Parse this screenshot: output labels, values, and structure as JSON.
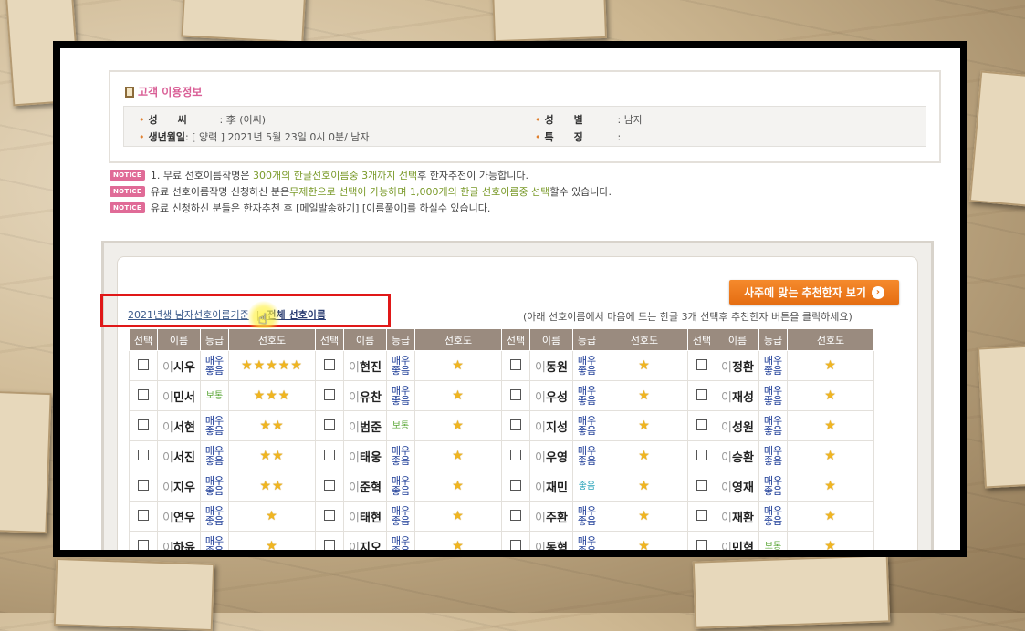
{
  "info": {
    "title": "고객 이용정보",
    "rows": [
      {
        "label": "성　　씨",
        "value": ": 李 (이씨)"
      },
      {
        "label": "생년월일",
        "value": ": [ 양력 ] 2021년 5월 23일 0시 0분/ 남자"
      },
      {
        "label": "성　　별",
        "value": ": 남자"
      },
      {
        "label": "특　　징",
        "value": ":"
      }
    ]
  },
  "notices": {
    "badge": "NOTICE",
    "n1": {
      "a": "1. 무료 선호이름작명은 ",
      "b": "300개의 한글선호이름중 3개까지 선택",
      "c": "후 한자추천이 가능합니다."
    },
    "n2": {
      "a": "유료 선호이름작명 신청하신 분은",
      "b": "무제한으로 선택이 가능하며 1,000개의 한글 선호이름중 선택",
      "c": "할수 있습니다."
    },
    "n3": {
      "a": "유료 신청하신 분들은 한자추천 후 [메일발송하기] [이름풀이]를 하실수 있습니다."
    }
  },
  "controls": {
    "link_year": "2021년생 남자선호이름기준",
    "separator": "|",
    "link_all": "전체 선호이름",
    "cta": "사주에 맞는 추천한자 보기",
    "cta_arrow": "›",
    "hint": "(아래 선호이름에서 마음에 드는 한글 3개 선택후 추천한자 버튼을 클릭하세요)"
  },
  "table": {
    "headers": [
      "선택",
      "이름",
      "등급",
      "선호도"
    ],
    "surname": "이",
    "grade_colors": {
      "최고": "#1a3a96",
      "보통": "#5ea83a",
      "좋음": "#2aa3b8"
    },
    "columns": [
      [
        {
          "given": "시우",
          "grade": "매우",
          "grade2": "좋음",
          "stars": 5
        },
        {
          "given": "민서",
          "grade": "보통",
          "grade2": "",
          "stars": 3
        },
        {
          "given": "서현",
          "grade": "매우",
          "grade2": "좋음",
          "stars": 2
        },
        {
          "given": "서진",
          "grade": "매우",
          "grade2": "좋음",
          "stars": 2
        },
        {
          "given": "지우",
          "grade": "매우",
          "grade2": "좋음",
          "stars": 2
        },
        {
          "given": "연우",
          "grade": "매우",
          "grade2": "좋음",
          "stars": 1
        },
        {
          "given": "하윤",
          "grade": "매우",
          "grade2": "좋음",
          "stars": 1
        }
      ],
      [
        {
          "given": "현진",
          "grade": "매우",
          "grade2": "좋음",
          "stars": 1
        },
        {
          "given": "유찬",
          "grade": "매우",
          "grade2": "좋음",
          "stars": 1
        },
        {
          "given": "범준",
          "grade": "보통",
          "grade2": "",
          "stars": 1
        },
        {
          "given": "태웅",
          "grade": "매우",
          "grade2": "좋음",
          "stars": 1
        },
        {
          "given": "준혁",
          "grade": "매우",
          "grade2": "좋음",
          "stars": 1
        },
        {
          "given": "태현",
          "grade": "매우",
          "grade2": "좋음",
          "stars": 1
        },
        {
          "given": "지오",
          "grade": "매우",
          "grade2": "좋음",
          "stars": 1
        }
      ],
      [
        {
          "given": "동원",
          "grade": "매우",
          "grade2": "좋음",
          "stars": 1
        },
        {
          "given": "우성",
          "grade": "매우",
          "grade2": "좋음",
          "stars": 1
        },
        {
          "given": "지성",
          "grade": "매우",
          "grade2": "좋음",
          "stars": 1
        },
        {
          "given": "우영",
          "grade": "매우",
          "grade2": "좋음",
          "stars": 1
        },
        {
          "given": "재민",
          "grade": "좋음",
          "grade2": "",
          "stars": 1
        },
        {
          "given": "주환",
          "grade": "매우",
          "grade2": "좋음",
          "stars": 1
        },
        {
          "given": "동혁",
          "grade": "매우",
          "grade2": "좋음",
          "stars": 1
        }
      ],
      [
        {
          "given": "정환",
          "grade": "매우",
          "grade2": "좋음",
          "stars": 1
        },
        {
          "given": "재성",
          "grade": "매우",
          "grade2": "좋음",
          "stars": 1
        },
        {
          "given": "성원",
          "grade": "매우",
          "grade2": "좋음",
          "stars": 1
        },
        {
          "given": "승환",
          "grade": "매우",
          "grade2": "좋음",
          "stars": 1
        },
        {
          "given": "영재",
          "grade": "매우",
          "grade2": "좋음",
          "stars": 1
        },
        {
          "given": "재환",
          "grade": "매우",
          "grade2": "좋음",
          "stars": 1
        },
        {
          "given": "민혁",
          "grade": "보통",
          "grade2": "",
          "stars": 1
        }
      ]
    ]
  }
}
